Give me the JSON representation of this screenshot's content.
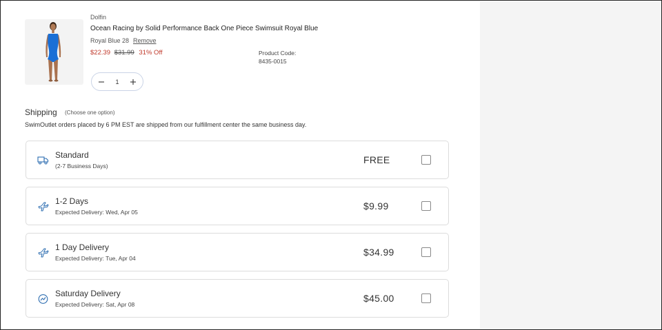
{
  "product": {
    "brand": "Dolfin",
    "name": "Ocean Racing by Solid Performance Back One Piece Swimsuit Royal Blue",
    "variant": "Royal Blue 28",
    "remove_label": "Remove",
    "price_sale": "$22.39",
    "price_original": "$31.99",
    "discount": "31% Off",
    "code_label": "Product Code:",
    "code_value": "8435-0015",
    "quantity": "1",
    "image_color": "#1a6fd6"
  },
  "shipping": {
    "title": "Shipping",
    "hint": "(Choose one option)",
    "note": "SwimOutlet orders placed by 6 PM EST are shipped from our fulfillment center the same business day.",
    "options": [
      {
        "icon": "truck-icon",
        "title": "Standard",
        "subtitle": "(2-7 Business Days)",
        "price": "FREE"
      },
      {
        "icon": "plane-icon",
        "title": "1-2 Days",
        "subtitle": "Expected Delivery: Wed, Apr 05",
        "price": "$9.99"
      },
      {
        "icon": "plane-icon",
        "title": "1 Day Delivery",
        "subtitle": "Expected Delivery: Tue, Apr 04",
        "price": "$34.99"
      },
      {
        "icon": "clock-icon",
        "title": "Saturday Delivery",
        "subtitle": "Expected Delivery: Sat, Apr 08",
        "price": "$45.00"
      }
    ]
  },
  "colors": {
    "accent_icon": "#2b6cb0",
    "sale": "#c0392b",
    "side_panel": "#f4f4f4"
  }
}
